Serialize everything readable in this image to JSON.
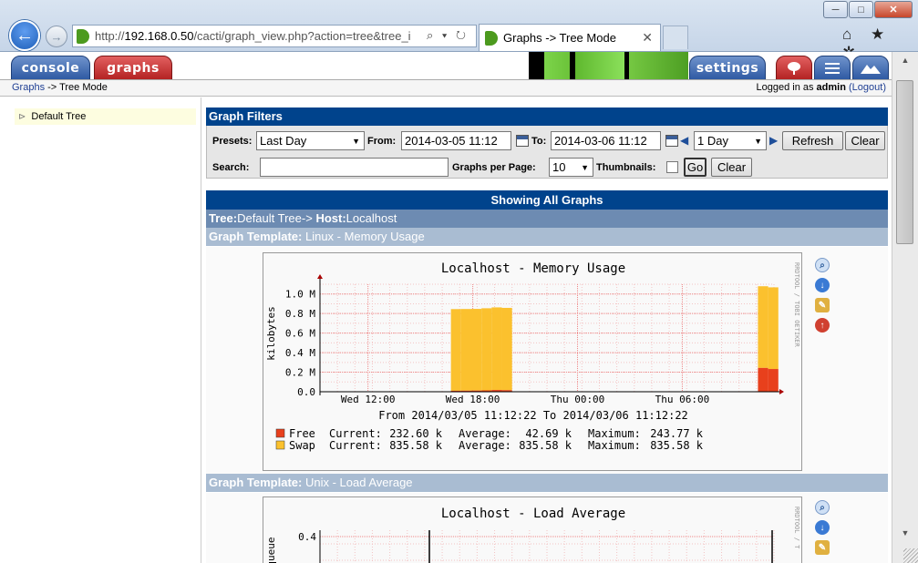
{
  "browser": {
    "url_prefix": "http://",
    "url_host": "192.168.0.50",
    "url_path": "/cacti/graph_view.php?action=tree&tree_i",
    "tab_title": "Graphs -> Tree Mode",
    "window_buttons": [
      "─",
      "□",
      "✕"
    ],
    "tab_close": "✕",
    "addr_icons": "⌕ ▾ ↻",
    "back_glyph": "←",
    "fwd_glyph": "→",
    "tool_icons": "⌂ ★ ✲"
  },
  "cacti": {
    "tabs": {
      "console": "console",
      "graphs": "graphs",
      "settings": "settings"
    },
    "breadcrumb_link": "Graphs",
    "breadcrumb_rest": "-> Tree Mode",
    "login_prefix": "Logged in as",
    "login_user": "admin",
    "logout": "(Logout)"
  },
  "tree": {
    "item": "Default Tree",
    "expander": "⊳"
  },
  "filters": {
    "title": "Graph Filters",
    "presets_label": "Presets:",
    "presets_value": "Last Day",
    "from_label": "From:",
    "from_value": "2014-03-05 11:12",
    "to_label": "To:",
    "to_value": "2014-03-06 11:12",
    "span_value": "1 Day",
    "refresh": "Refresh",
    "clear": "Clear",
    "search_label": "Search:",
    "search_value": "",
    "gpp_label": "Graphs per Page:",
    "gpp_value": "10",
    "thumbs_label": "Thumbnails:",
    "go": "Go",
    "clear2": "Clear"
  },
  "listing": {
    "show_all": "Showing All Graphs",
    "tree_label": "Tree:",
    "tree_value": "Default Tree->",
    "host_label": "Host:",
    "host_value": "Localhost",
    "tpl_label": "Graph Template:",
    "tpl1": "Linux - Memory Usage",
    "tpl2": "Unix - Load Average"
  },
  "graph1": {
    "title": "Localhost - Memory Usage",
    "ylabel": "kilobytes",
    "side_label": "RRDTOOL / TOBI OETIKER",
    "range": "From 2014/03/05 11:12:22 To 2014/03/06 11:12:22",
    "legend": [
      {
        "name": "Free",
        "color": "#e8401c",
        "current": "232.60 k",
        "average": "42.69 k",
        "maximum": "243.77 k"
      },
      {
        "name": "Swap",
        "color": "#fbc12e",
        "current": "835.58 k",
        "average": "835.58 k",
        "maximum": "835.58 k"
      }
    ],
    "current_label": "Current:",
    "average_label": "Average:",
    "maximum_label": "Maximum:"
  },
  "graph2": {
    "title": "Localhost - Load Average",
    "ylabel": "un queue",
    "side_label": "RRDTOOL / T",
    "ytick_top": "0.4"
  },
  "colors": {
    "header_blue": "#00438c",
    "free": "#e8401c",
    "swap": "#fbc12e",
    "grid": "#f0a0a0"
  },
  "chart_data": {
    "type": "area",
    "title": "Localhost - Memory Usage",
    "xlabel": "",
    "ylabel": "kilobytes",
    "ylim": [
      0,
      1100000
    ],
    "ytick_labels": [
      "0.0",
      "0.2 M",
      "0.4 M",
      "0.6 M",
      "0.8 M",
      "1.0 M"
    ],
    "yticks": [
      0,
      200000,
      400000,
      600000,
      800000,
      1000000
    ],
    "xtick_labels": [
      "Wed 12:00",
      "Wed 18:00",
      "Thu 00:00",
      "Thu 06:00"
    ],
    "x": [
      "Wed 16:45",
      "Wed 17:20",
      "Wed 17:55",
      "Wed 18:30",
      "Wed 19:05",
      "Wed 19:40",
      "Thu 10:20",
      "Thu 10:55"
    ],
    "series": [
      {
        "name": "Free",
        "values": [
          10000,
          11000,
          12000,
          14000,
          18000,
          16000,
          243770,
          232600
        ]
      },
      {
        "name": "Swap",
        "values": [
          835580,
          835580,
          835580,
          840000,
          845000,
          842000,
          835580,
          835580
        ]
      }
    ]
  }
}
